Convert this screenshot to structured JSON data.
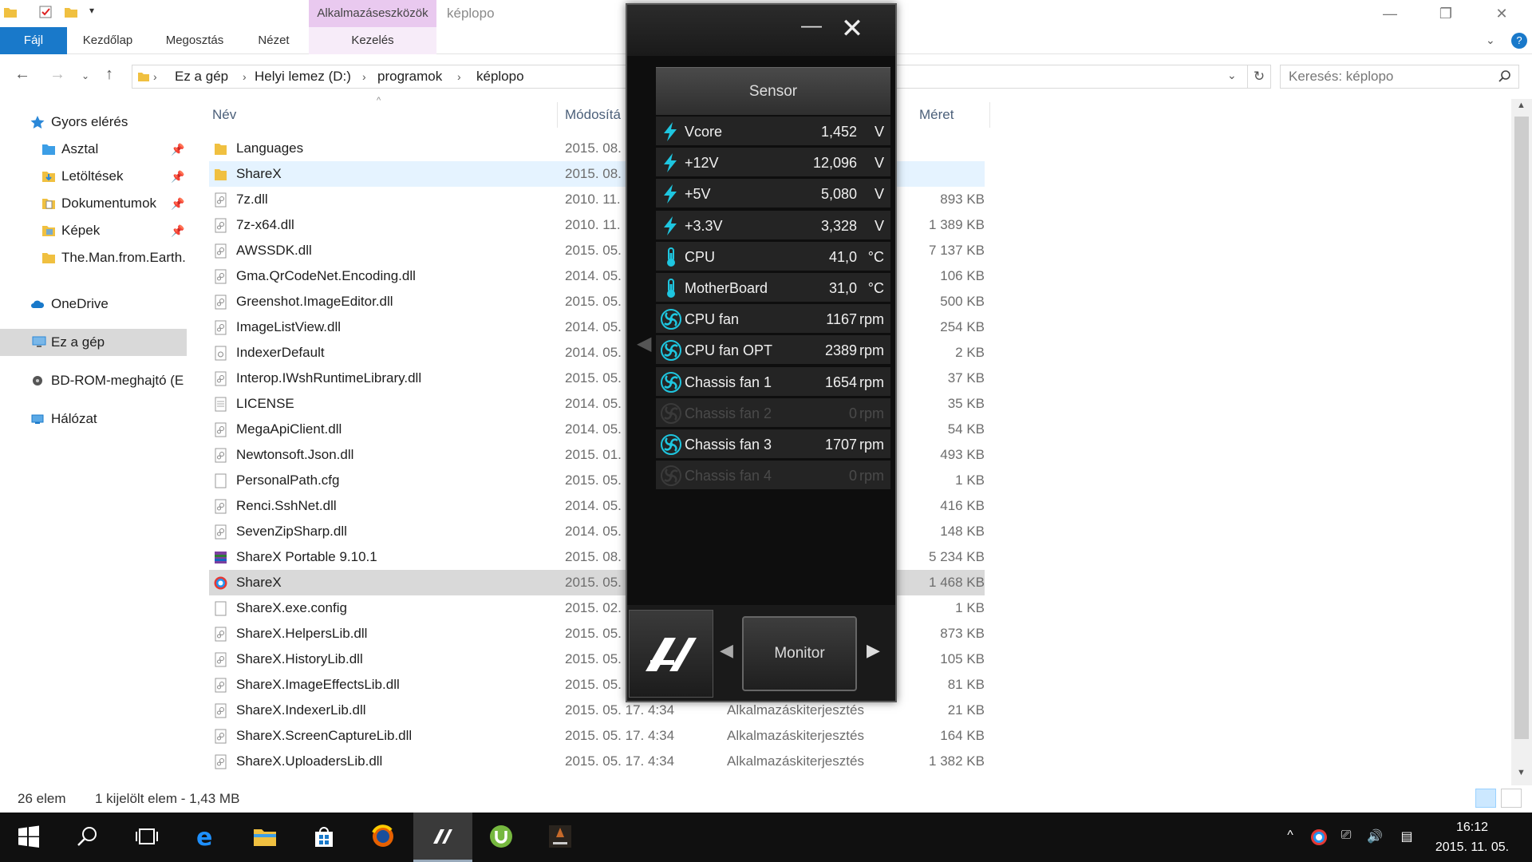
{
  "explorer": {
    "window_title": "képlopo",
    "ribbon": {
      "tabs": [
        "Fájl",
        "Kezdőlap",
        "Megosztás",
        "Nézet"
      ],
      "contextual_group": "Alkalmazáseszközök",
      "contextual_tab": "Kezelés",
      "help": "?"
    },
    "address": {
      "crumbs": [
        "Ez a gép",
        "Helyi lemez (D:)",
        "programok",
        "képlopo"
      ],
      "search_placeholder": "Keresés: képlopo"
    },
    "sidebar": {
      "items": [
        {
          "label": "Gyors elérés",
          "icon": "star-icon"
        },
        {
          "label": "Asztal",
          "icon": "folder-icon",
          "pinned": true
        },
        {
          "label": "Letöltések",
          "icon": "download-folder-icon",
          "pinned": true
        },
        {
          "label": "Dokumentumok",
          "icon": "documents-folder-icon",
          "pinned": true
        },
        {
          "label": "Képek",
          "icon": "pictures-folder-icon",
          "pinned": true
        },
        {
          "label": "The.Man.from.Earth.",
          "icon": "folder-icon"
        },
        {
          "label": "OneDrive",
          "icon": "cloud-icon"
        },
        {
          "label": "Ez a gép",
          "icon": "computer-icon",
          "selected": true
        },
        {
          "label": "BD-ROM-meghajtó (E",
          "icon": "disc-drive-icon"
        },
        {
          "label": "Hálózat",
          "icon": "network-icon"
        }
      ]
    },
    "columns": {
      "name": "Név",
      "modified": "Módosítá",
      "size": "Méret"
    },
    "files": [
      {
        "name": "Languages",
        "date": "2015. 08.",
        "type": "",
        "size": "",
        "kind": "folder"
      },
      {
        "name": "ShareX",
        "date": "2015. 08.",
        "type": "",
        "size": "",
        "kind": "folder"
      },
      {
        "name": "7z.dll",
        "date": "2010. 11.",
        "type": "",
        "size": "893 KB",
        "kind": "dll"
      },
      {
        "name": "7z-x64.dll",
        "date": "2010. 11.",
        "type": "",
        "size": "1 389 KB",
        "kind": "dll"
      },
      {
        "name": "AWSSDK.dll",
        "date": "2015. 05.",
        "type": "",
        "size": "7 137 KB",
        "kind": "dll"
      },
      {
        "name": "Gma.QrCodeNet.Encoding.dll",
        "date": "2014. 05.",
        "type": "",
        "size": "106 KB",
        "kind": "dll"
      },
      {
        "name": "Greenshot.ImageEditor.dll",
        "date": "2015. 05.",
        "type": "",
        "size": "500 KB",
        "kind": "dll"
      },
      {
        "name": "ImageListView.dll",
        "date": "2014. 05.",
        "type": "",
        "size": "254 KB",
        "kind": "dll"
      },
      {
        "name": "IndexerDefault",
        "date": "2014. 05.",
        "type": "",
        "size": "2 KB",
        "kind": "config"
      },
      {
        "name": "Interop.IWshRuntimeLibrary.dll",
        "date": "2015. 05.",
        "type": "",
        "size": "37 KB",
        "kind": "dll"
      },
      {
        "name": "LICENSE",
        "date": "2014. 05.",
        "type": "",
        "size": "35 KB",
        "kind": "text"
      },
      {
        "name": "MegaApiClient.dll",
        "date": "2014. 05.",
        "type": "",
        "size": "54 KB",
        "kind": "dll"
      },
      {
        "name": "Newtonsoft.Json.dll",
        "date": "2015. 01.",
        "type": "",
        "size": "493 KB",
        "kind": "dll"
      },
      {
        "name": "PersonalPath.cfg",
        "date": "2015. 05.",
        "type": "",
        "size": "1 KB",
        "kind": "file"
      },
      {
        "name": "Renci.SshNet.dll",
        "date": "2014. 05.",
        "type": "",
        "size": "416 KB",
        "kind": "dll"
      },
      {
        "name": "SevenZipSharp.dll",
        "date": "2014. 05.",
        "type": "",
        "size": "148 KB",
        "kind": "dll"
      },
      {
        "name": "ShareX Portable 9.10.1",
        "date": "2015. 08.",
        "type": "",
        "size": "5 234 KB",
        "kind": "archive"
      },
      {
        "name": "ShareX",
        "date": "2015. 05.",
        "type": "",
        "size": "1 468 KB",
        "kind": "sharex-app"
      },
      {
        "name": "ShareX.exe.config",
        "date": "2015. 02.",
        "type": "",
        "size": "1 KB",
        "kind": "file"
      },
      {
        "name": "ShareX.HelpersLib.dll",
        "date": "2015. 05.",
        "type": "",
        "size": "873 KB",
        "kind": "dll"
      },
      {
        "name": "ShareX.HistoryLib.dll",
        "date": "2015. 05.",
        "type": "",
        "size": "105 KB",
        "kind": "dll"
      },
      {
        "name": "ShareX.ImageEffectsLib.dll",
        "date": "2015. 05.",
        "type": "",
        "size": "81 KB",
        "kind": "dll"
      },
      {
        "name": "ShareX.IndexerLib.dll",
        "date": "2015. 05. 17. 4:34",
        "type": "Alkalmazáskiterjesztés",
        "size": "21 KB",
        "kind": "dll"
      },
      {
        "name": "ShareX.ScreenCaptureLib.dll",
        "date": "2015. 05. 17. 4:34",
        "type": "Alkalmazáskiterjesztés",
        "size": "164 KB",
        "kind": "dll"
      },
      {
        "name": "ShareX.UploadersLib.dll",
        "date": "2015. 05. 17. 4:34",
        "type": "Alkalmazáskiterjesztés",
        "size": "1 382 KB",
        "kind": "dll"
      }
    ],
    "status": {
      "count": "26 elem",
      "selection": "1 kijelölt elem - 1,43 MB"
    }
  },
  "sensor_widget": {
    "title": "Sensor",
    "rows": [
      {
        "label": "Vcore",
        "value": "1,452",
        "unit": "V",
        "icon": "lightning-icon",
        "active": true
      },
      {
        "label": "+12V",
        "value": "12,096",
        "unit": "V",
        "icon": "lightning-icon",
        "active": true
      },
      {
        "label": "+5V",
        "value": "5,080",
        "unit": "V",
        "icon": "lightning-icon",
        "active": true
      },
      {
        "label": "+3.3V",
        "value": "3,328",
        "unit": "V",
        "icon": "lightning-icon",
        "active": true
      },
      {
        "label": "CPU",
        "value": "41,0",
        "unit": "°C",
        "icon": "thermometer-icon",
        "active": true
      },
      {
        "label": "MotherBoard",
        "value": "31,0",
        "unit": "°C",
        "icon": "thermometer-icon",
        "active": true
      },
      {
        "label": "CPU fan",
        "value": "1167",
        "unit": "rpm",
        "icon": "fan-icon",
        "active": true
      },
      {
        "label": "CPU fan OPT",
        "value": "2389",
        "unit": "rpm",
        "icon": "fan-icon",
        "active": true
      },
      {
        "label": "Chassis fan 1",
        "value": "1654",
        "unit": "rpm",
        "icon": "fan-icon",
        "active": true
      },
      {
        "label": "Chassis fan 2",
        "value": "0",
        "unit": "rpm",
        "icon": "fan-icon",
        "active": false
      },
      {
        "label": "Chassis fan 3",
        "value": "1707",
        "unit": "rpm",
        "icon": "fan-icon",
        "active": true
      },
      {
        "label": "Chassis fan 4",
        "value": "0",
        "unit": "rpm",
        "icon": "fan-icon",
        "active": false
      }
    ],
    "mode_button": "Monitor",
    "colors": {
      "accent": "#1ec6e0"
    }
  },
  "taskbar": {
    "clock_time": "16:12",
    "clock_date": "2015. 11. 05.",
    "apps": [
      "start-icon",
      "search-icon",
      "task-view-icon",
      "edge-icon",
      "file-explorer-icon",
      "store-icon",
      "firefox-icon",
      "ai-suite-icon",
      "utorrent-icon",
      "battlefield-icon"
    ]
  }
}
